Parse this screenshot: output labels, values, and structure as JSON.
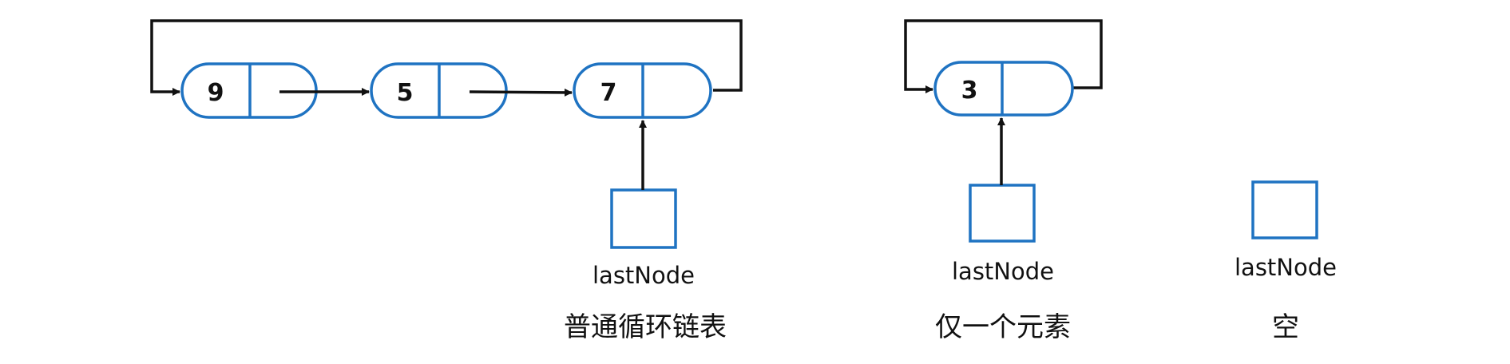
{
  "diagrams": [
    {
      "caption": "普通循环链表",
      "nodes": [
        "9",
        "5",
        "7"
      ],
      "pointer_label": "lastNode"
    },
    {
      "caption": "仅一个元素",
      "nodes": [
        "3"
      ],
      "pointer_label": "lastNode"
    },
    {
      "caption": "空",
      "nodes": [],
      "pointer_label": "lastNode"
    }
  ],
  "colors": {
    "node_border": "#1f73c2",
    "line": "#111111"
  }
}
